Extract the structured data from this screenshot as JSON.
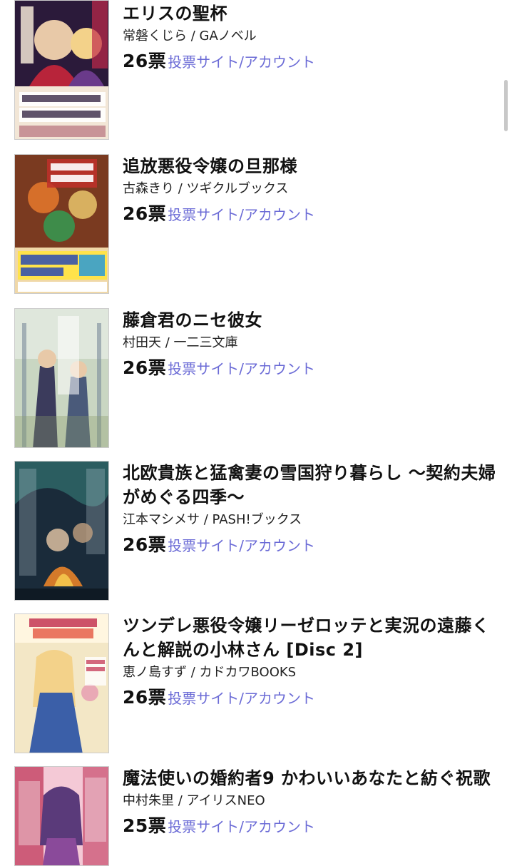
{
  "books": [
    {
      "title": "エリスの聖杯",
      "author_publisher": "常磐くじら / GAノベル",
      "votes": "26票",
      "vote_link": "投票サイト/アカウント",
      "cover_colors": [
        "#2b1a3a",
        "#b8243a",
        "#f2e6d6"
      ]
    },
    {
      "title": "追放悪役令嬢の旦那様",
      "author_publisher": "古森きり / ツギクルブックス",
      "votes": "26票",
      "vote_link": "投票サイト/アカウント",
      "cover_colors": [
        "#7a3a20",
        "#d66f2a",
        "#3e8c4a"
      ]
    },
    {
      "title": "藤倉君のニセ彼女",
      "author_publisher": "村田天 / 一二三文庫",
      "votes": "26票",
      "vote_link": "投票サイト/アカウント",
      "cover_colors": [
        "#c9d6c2",
        "#7a8a9a",
        "#3b3b5c"
      ]
    },
    {
      "title": "北欧貴族と猛禽妻の雪国狩り暮らし 〜契約夫婦がめぐる四季〜",
      "author_publisher": "江本マシメサ / PASH!ブックス",
      "votes": "26票",
      "vote_link": "投票サイト/アカウント",
      "cover_colors": [
        "#1a2b3a",
        "#2f6a6a",
        "#d47a2a"
      ]
    },
    {
      "title": "ツンデレ悪役令嬢リーゼロッテと実況の遠藤くんと解説の小林さん [Disc 2]",
      "author_publisher": "恵ノ島すず / カドカワBOOKS",
      "votes": "26票",
      "vote_link": "投票サイト/アカウント",
      "cover_colors": [
        "#f3e7c6",
        "#3b5fa8",
        "#e69ab0"
      ]
    },
    {
      "title": "魔法使いの婚約者9 かわいいあなたと紡ぐ祝歌",
      "author_publisher": "中村朱里 / アイリスNEO",
      "votes": "25票",
      "vote_link": "投票サイト/アカウント",
      "cover_colors": [
        "#f4c9d6",
        "#c0375a",
        "#5a3a7a"
      ]
    }
  ],
  "colors": {
    "link": "#6b6bd6",
    "text": "#111111",
    "scrollbar": "#c8c8c8"
  }
}
